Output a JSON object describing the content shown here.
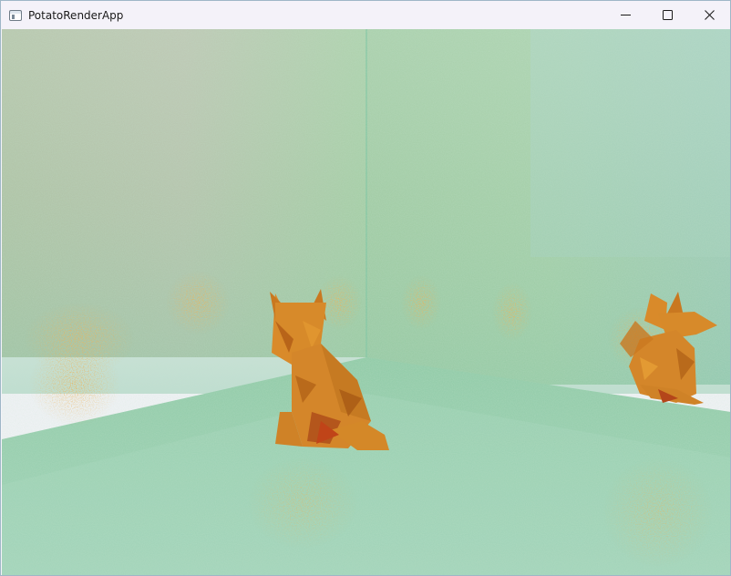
{
  "window": {
    "title": "PotatoRenderApp",
    "app_icon": "window-app-icon",
    "controls": {
      "minimize": {
        "icon": "minimize-icon",
        "glyph": "—"
      },
      "maximize": {
        "icon": "maximize-icon"
      },
      "close": {
        "icon": "close-icon"
      }
    }
  },
  "scene": {
    "description_colors": {
      "wall_left": "#a6c7a4",
      "wall_right": "#9dcfb0",
      "floor": "#9fd1b7",
      "fox": "#d78a2a",
      "fox_dark": "#b4651a",
      "noise_orange": "#d0802b"
    }
  }
}
